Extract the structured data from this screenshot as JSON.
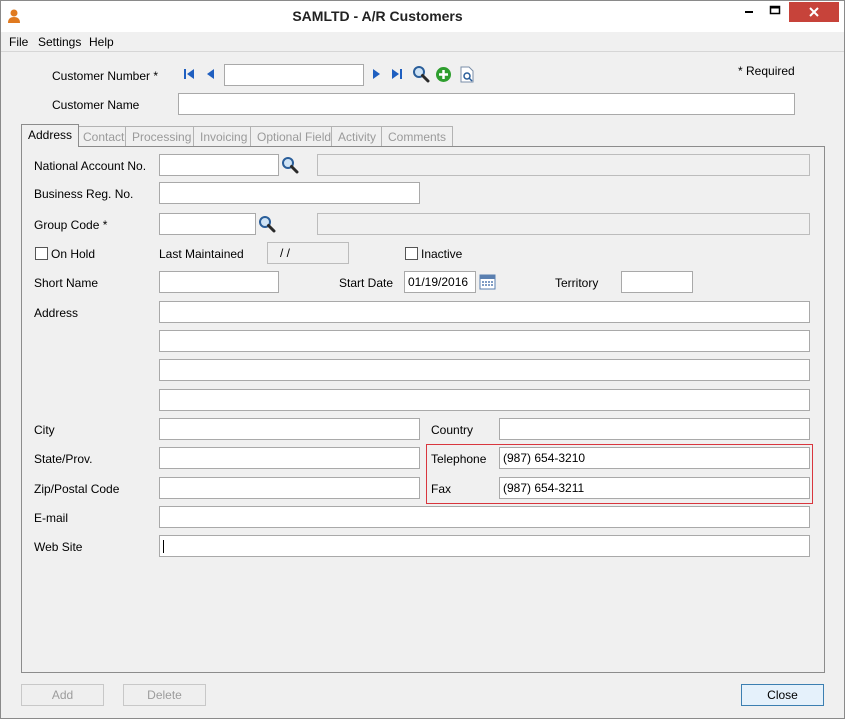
{
  "window": {
    "title": "SAMLTD - A/R Customers",
    "controls": {
      "minimize": "▬",
      "maximize": "□",
      "close": "✕"
    }
  },
  "menu": [
    "File",
    "Settings",
    "Help"
  ],
  "header": {
    "customer_number_label": "Customer Number *",
    "customer_number_value": "",
    "customer_name_label": "Customer Name",
    "customer_name_value": "",
    "required_note": "*   Required"
  },
  "tabs": [
    {
      "label": "Address",
      "active": true
    },
    {
      "label": "Contact",
      "active": false
    },
    {
      "label": "Processing",
      "active": false
    },
    {
      "label": "Invoicing",
      "active": false
    },
    {
      "label": "Optional Fields",
      "active": false
    },
    {
      "label": "Activity",
      "active": false
    },
    {
      "label": "Comments",
      "active": false
    }
  ],
  "address": {
    "national_account_label": "National Account No.",
    "national_account_value": "",
    "national_account_desc": "",
    "business_reg_label": "Business Reg. No.",
    "business_reg_value": "",
    "group_code_label": "Group Code *",
    "group_code_value": "",
    "group_code_desc": "",
    "on_hold_label": "On Hold",
    "on_hold_checked": false,
    "last_maintained_label": "Last Maintained",
    "last_maintained_value": "/  /",
    "inactive_label": "Inactive",
    "inactive_checked": false,
    "short_name_label": "Short Name",
    "short_name_value": "",
    "start_date_label": "Start Date",
    "start_date_value": "01/19/2016",
    "territory_label": "Territory",
    "territory_value": "",
    "address_label": "Address",
    "address_lines": [
      "",
      "",
      "",
      ""
    ],
    "city_label": "City",
    "city_value": "",
    "country_label": "Country",
    "country_value": "",
    "state_label": "State/Prov.",
    "state_value": "",
    "telephone_label": "Telephone",
    "telephone_value": "(987) 654-3210",
    "zip_label": "Zip/Postal Code",
    "zip_value": "",
    "fax_label": "Fax",
    "fax_value": "(987) 654-3211",
    "email_label": "E-mail",
    "email_value": "",
    "website_label": "Web Site",
    "website_value": ""
  },
  "footer": {
    "add_label": "Add",
    "delete_label": "Delete",
    "close_label": "Close"
  },
  "colors": {
    "highlight_border": "#d9363e",
    "nav_arrow": "#1f5fc0",
    "add_icon": "#2e9e2e",
    "close_button": "#c7433a"
  }
}
